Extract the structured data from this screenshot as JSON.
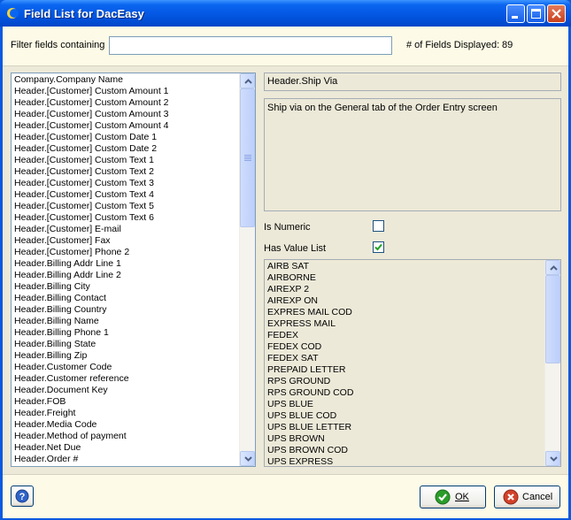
{
  "window": {
    "title": "Field List for DacEasy"
  },
  "filter": {
    "label": "Filter fields containing",
    "value": "",
    "count_label": "# of Fields Displayed:",
    "count_value": "89"
  },
  "fields": [
    "Company.Company Name",
    "Header.[Customer] Custom Amount 1",
    "Header.[Customer] Custom Amount 2",
    "Header.[Customer] Custom Amount 3",
    "Header.[Customer] Custom Amount 4",
    "Header.[Customer] Custom Date 1",
    "Header.[Customer] Custom Date 2",
    "Header.[Customer] Custom Text 1",
    "Header.[Customer] Custom Text 2",
    "Header.[Customer] Custom Text 3",
    "Header.[Customer] Custom Text 4",
    "Header.[Customer] Custom Text 5",
    "Header.[Customer] Custom Text 6",
    "Header.[Customer] E-mail",
    "Header.[Customer] Fax",
    "Header.[Customer] Phone 2",
    "Header.Billing Addr Line 1",
    "Header.Billing Addr Line 2",
    "Header.Billing City",
    "Header.Billing Contact",
    "Header.Billing Country",
    "Header.Billing Name",
    "Header.Billing Phone 1",
    "Header.Billing State",
    "Header.Billing Zip",
    "Header.Customer Code",
    "Header.Customer reference",
    "Header.Document Key",
    "Header.FOB",
    "Header.Freight",
    "Header.Media Code",
    "Header.Method of payment",
    "Header.Net Due",
    "Header.Order #"
  ],
  "detail": {
    "field_name": "Header.Ship Via",
    "description": "Ship via on the General tab of the Order Entry screen",
    "is_numeric_label": "Is Numeric",
    "is_numeric": false,
    "has_value_list_label": "Has Value List",
    "has_value_list": true
  },
  "value_list": [
    "AIRB SAT",
    "AIRBORNE",
    "AIREXP 2",
    "AIREXP ON",
    "EXPRES MAIL COD",
    "EXPRESS MAIL",
    "FEDEX",
    "FEDEX COD",
    "FEDEX SAT",
    "PREPAID LETTER",
    "RPS GROUND",
    "RPS GROUND COD",
    "UPS BLUE",
    "UPS BLUE COD",
    "UPS BLUE LETTER",
    "UPS BROWN",
    "UPS BROWN COD",
    "UPS EXPRESS"
  ],
  "buttons": {
    "ok_label": "OK",
    "cancel_label": "Cancel"
  },
  "icons": {
    "help": "help-icon",
    "ok": "checkmark-icon",
    "cancel": "cancel-icon"
  },
  "colors": {
    "titlebar": "#0355e0",
    "panel": "#ece9d8",
    "accent_green": "#2a9c2a",
    "accent_red": "#c8401c"
  }
}
